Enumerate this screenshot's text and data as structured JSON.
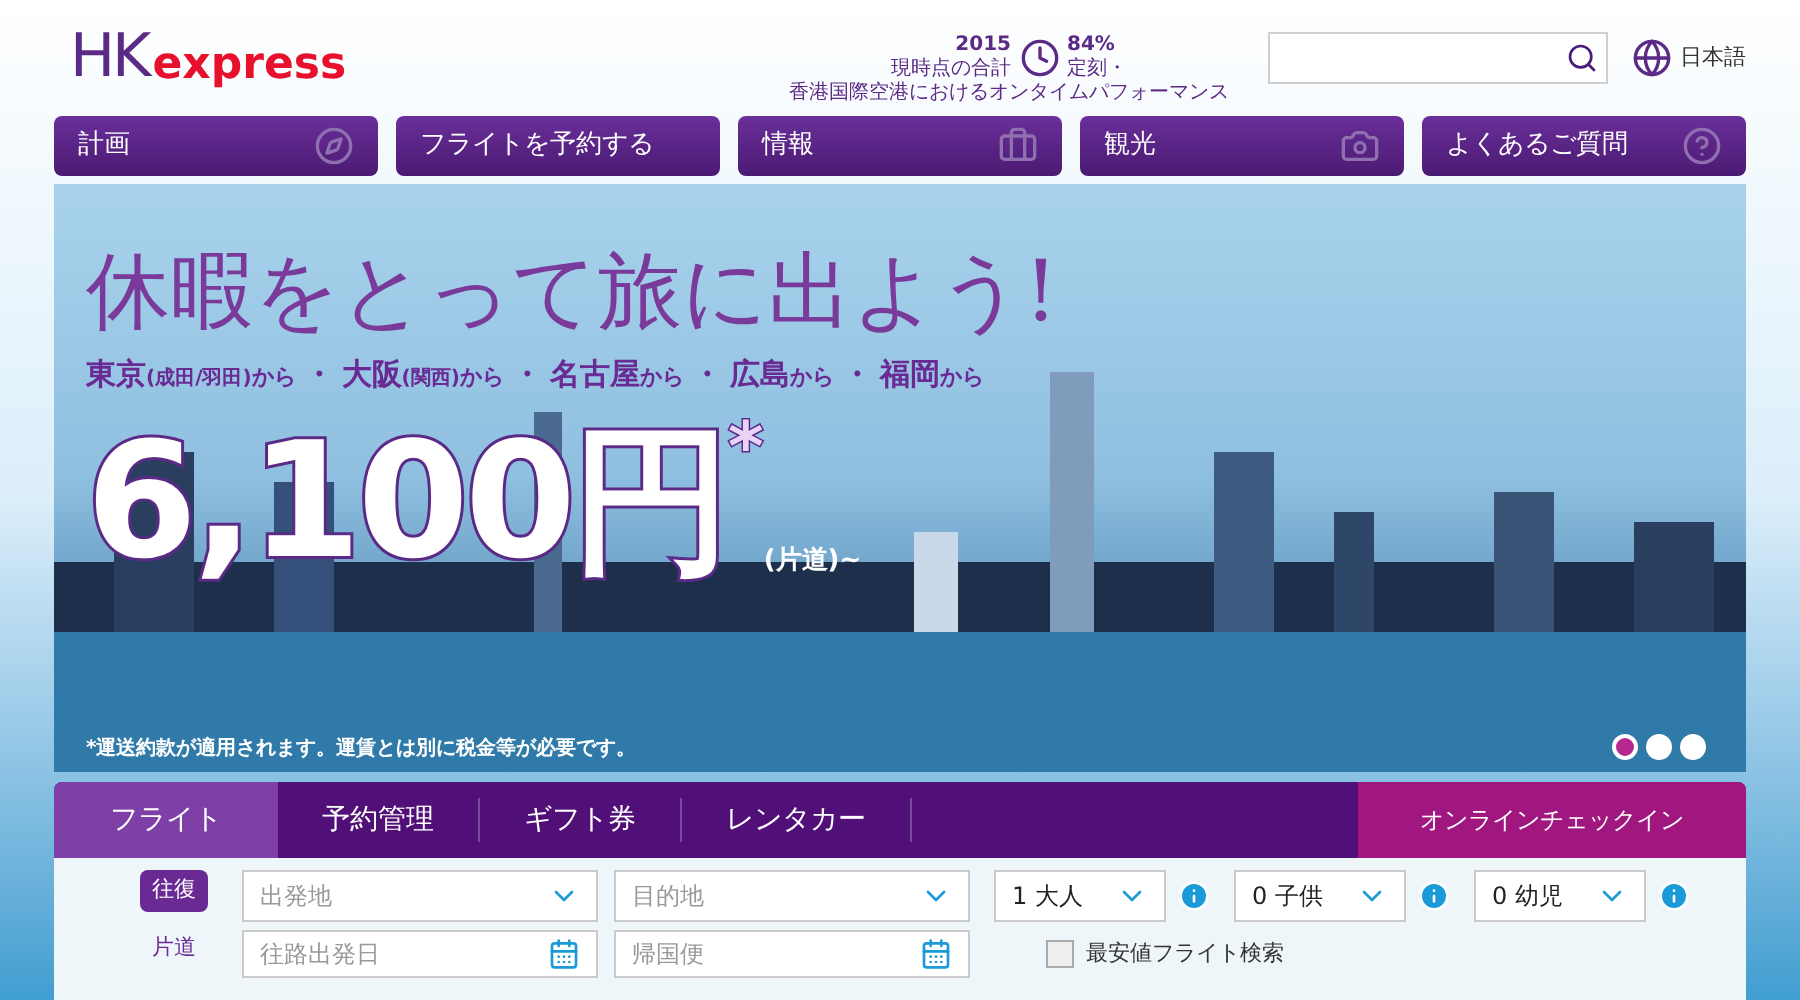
{
  "header": {
    "logo": {
      "hk": "HK",
      "express": "express"
    },
    "stats": {
      "year": "2015",
      "period": "現時点の合計",
      "percent": "84%",
      "label": "定刻・",
      "caption": "香港国際空港におけるオンタイムパフォーマンス"
    },
    "language": "日本語"
  },
  "nav": [
    {
      "label": "計画"
    },
    {
      "label": "フライトを予約する"
    },
    {
      "label": "情報"
    },
    {
      "label": "観光"
    },
    {
      "label": "よくあるご質問"
    }
  ],
  "hero": {
    "headline": "休暇をとって旅に出よう!",
    "origins": [
      {
        "city": "東京",
        "note": "(成田/羽田)",
        "suffix": "から"
      },
      {
        "city": "大阪",
        "note": "(関西)",
        "suffix": "から"
      },
      {
        "city": "名古屋",
        "suffix": "から"
      },
      {
        "city": "広島",
        "suffix": "から"
      },
      {
        "city": "福岡",
        "suffix": "から"
      }
    ],
    "separator": "・",
    "price": "6,100円",
    "asterisk": "*",
    "price_note": "(片道)~",
    "disclaimer": "*運送約款が適用されます。運賃とは別に税金等が必要です。",
    "dots": [
      {
        "selected": true
      },
      {
        "selected": false
      },
      {
        "selected": false
      }
    ]
  },
  "booking": {
    "tabs": [
      {
        "label": "フライト",
        "selected": true
      },
      {
        "label": "予約管理",
        "selected": false
      },
      {
        "label": "ギフト券",
        "selected": false
      },
      {
        "label": "レンタカー",
        "selected": false
      }
    ],
    "checkin": "オンラインチェックイン",
    "trip_types": [
      {
        "label": "往復",
        "selected": true
      },
      {
        "label": "片道",
        "selected": false
      }
    ],
    "row1": [
      {
        "kind": "select",
        "placeholder": "出発地"
      },
      {
        "kind": "select",
        "placeholder": "目的地"
      }
    ],
    "passengers": [
      {
        "value": "1 大人"
      },
      {
        "value": "0 子供"
      },
      {
        "value": "0 幼児"
      }
    ],
    "row2": [
      {
        "kind": "date",
        "placeholder": "往路出発日"
      },
      {
        "kind": "date",
        "placeholder": "帰国便"
      }
    ],
    "cheapest": {
      "label": "最安値フライト検索",
      "checked": false
    }
  }
}
